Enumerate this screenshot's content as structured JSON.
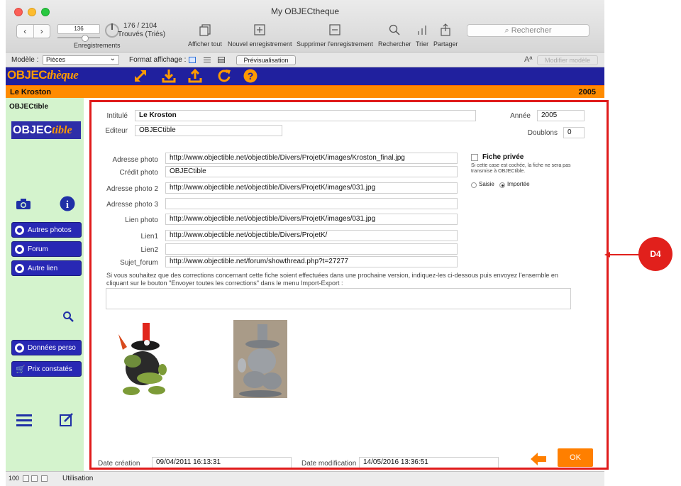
{
  "window": {
    "title": "My OBJECtheque"
  },
  "toolbar": {
    "record_field_value": "136",
    "records_label": "Enregistrements",
    "count_line1": "176 / 2104",
    "count_line2": "Trouvés (Triés)",
    "show_all": "Afficher tout",
    "new_record": "Nouvel enregistrement",
    "delete_record": "Supprimer l'enregistrement",
    "search": "Rechercher",
    "sort": "Trier",
    "share": "Partager",
    "search_placeholder": "Rechercher"
  },
  "modelbar": {
    "model_label": "Modèle :",
    "model_value": "Pièces",
    "format_label": "Format affichage :",
    "preview": "Prévisualisation",
    "modify_model": "Modifier modèle",
    "aa": "Aª"
  },
  "banner": {
    "logo_a": "OBJEC",
    "logo_b": "thèque"
  },
  "record": {
    "title": "Le Kroston",
    "year": "2005"
  },
  "sidebar": {
    "title": "OBJECtible",
    "logo_a": "OBJEC",
    "logo_b": "tible",
    "buttons": {
      "autres_photos": "Autres photos",
      "forum": "Forum",
      "autre_lien": "Autre lien",
      "donnees_perso": "Données perso",
      "prix_constates": "Prix constatés"
    }
  },
  "form": {
    "intitule_label": "Intitulé",
    "intitule_value": "Le Kroston",
    "editeur_label": "Editeur",
    "editeur_value": "OBJECtible",
    "annee_label": "Année",
    "annee_value": "2005",
    "doublons_label": "Doublons",
    "doublons_value": "0",
    "adresse_photo_label": "Adresse photo",
    "adresse_photo_value": "http://www.objectible.net/objectible/Divers/ProjetK/images/Kroston_final.jpg",
    "credit_photo_label": "Crédit photo",
    "credit_photo_value": "OBJECtible",
    "adresse_photo2_label": "Adresse photo 2",
    "adresse_photo2_value": "http://www.objectible.net/objectible/Divers/ProjetK/images/031.jpg",
    "adresse_photo3_label": "Adresse photo 3",
    "adresse_photo3_value": "",
    "lien_photo_label": "Lien photo",
    "lien_photo_value": "http://www.objectible.net/objectible/Divers/ProjetK/images/031.jpg",
    "lien1_label": "Lien1",
    "lien1_value": "http://www.objectible.net/objectible/Divers/ProjetK/",
    "lien2_label": "Lien2",
    "lien2_value": "",
    "sujet_forum_label": "Sujet_forum",
    "sujet_forum_value": "http://www.objectible.net/forum/showthread.php?t=27277",
    "fiche_privee_label": "Fiche privée",
    "fiche_privee_note": "Si cette case est cochée, la fiche ne sera pas transmise à OBJECtible.",
    "radio_saisie": "Saisie",
    "radio_importee": "Importée",
    "corrections_text": "Si vous souhaitez que des corrections concernant cette fiche soient effectuées dans une prochaine version, indiquez-les ci-dessous puis envoyez l'ensemble en cliquant sur le bouton \"Envoyer toutes les corrections\" dans le menu Import-Export :",
    "corrections_value": "",
    "date_creation_label": "Date création",
    "date_creation_value": "09/04/2011 16:13:31",
    "date_modification_label": "Date modification",
    "date_modification_value": "14/05/2016 13:36:51",
    "ok": "OK"
  },
  "status": {
    "zoom": "100",
    "mode": "Utilisation"
  },
  "annotation": {
    "label": "D4"
  },
  "colors": {
    "banner_blue": "#20209e",
    "orange": "#ff8b00",
    "sidebar_green": "#d4f3cd",
    "annotation_red": "#e01b1b"
  }
}
